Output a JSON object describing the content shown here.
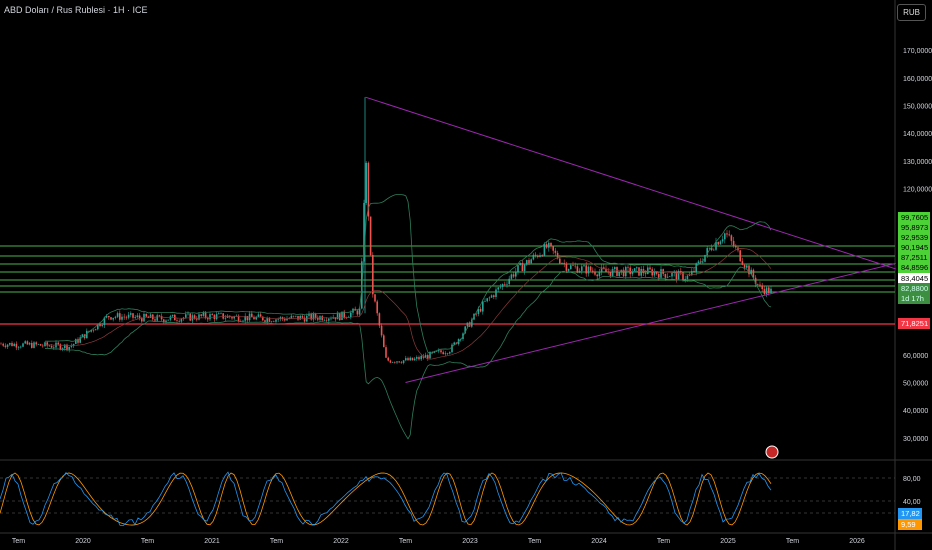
{
  "header": {
    "title": "ABD Doları / Rus Rublesi · 1H · ICE",
    "currency_button": "RUB"
  },
  "colors": {
    "up": "#26a69a",
    "down": "#ef5350",
    "green_line": "#4caf50",
    "red_line": "#f23645",
    "triangle": "#9c27b0",
    "bb": "#2e7d5b",
    "rsi": "#2196f3",
    "rsi_ma": "#ff9800"
  },
  "chart_data": {
    "type": "candlestick",
    "title": "ABD Doları / Rus Rublesi · 1H · ICE",
    "ylim": [
      20,
      180
    ],
    "y_ticks": [
      "170,0000",
      "160,0000",
      "150,0000",
      "140,0000",
      "130,0000",
      "120,0000",
      "60,0000",
      "50,0000",
      "40,0000",
      "30,0000"
    ],
    "y_tick_values": [
      170,
      160,
      150,
      140,
      130,
      120,
      60,
      50,
      40,
      30
    ],
    "x_ticks": [
      "Tem",
      "2020",
      "Tem",
      "2021",
      "Tem",
      "2022",
      "Tem",
      "2023",
      "Tem",
      "2024",
      "Tem",
      "2025",
      "Tem",
      "2026"
    ],
    "x_tick_values": [
      2019.5,
      2020,
      2020.5,
      2021,
      2021.5,
      2022,
      2022.5,
      2023,
      2023.5,
      2024,
      2024.5,
      2025,
      2025.5,
      2026
    ],
    "price_path": [
      [
        2019.36,
        64
      ],
      [
        2019.9,
        63
      ],
      [
        2020.2,
        74
      ],
      [
        2020.6,
        73
      ],
      [
        2021,
        74
      ],
      [
        2021.5,
        73
      ],
      [
        2022.0,
        74
      ],
      [
        2022.15,
        76
      ],
      [
        2022.19,
        133
      ],
      [
        2022.24,
        84
      ],
      [
        2022.35,
        58
      ],
      [
        2022.55,
        58
      ],
      [
        2022.85,
        62
      ],
      [
        2023.1,
        78
      ],
      [
        2023.35,
        90
      ],
      [
        2023.6,
        99
      ],
      [
        2023.75,
        92
      ],
      [
        2024.0,
        90
      ],
      [
        2024.4,
        90
      ],
      [
        2024.7,
        88
      ],
      [
        2024.85,
        98
      ],
      [
        2024.98,
        104
      ],
      [
        2025.1,
        95
      ],
      [
        2025.25,
        84
      ],
      [
        2025.33,
        82.9
      ]
    ],
    "level_labels": [
      {
        "text": "99,7605",
        "color": "#4caf50"
      },
      {
        "text": "95,8973",
        "color": "#4caf50"
      },
      {
        "text": "92,9539",
        "color": "#4caf50"
      },
      {
        "text": "90,1945",
        "color": "#4caf50"
      },
      {
        "text": "87,2511",
        "color": "#4caf50"
      },
      {
        "text": "84,8596",
        "color": "#4caf50"
      },
      {
        "text": "83,4045",
        "color": "#ffffff"
      },
      {
        "text": "82,8800",
        "color": "#4caf50"
      },
      {
        "text": "1d 17h",
        "color": "#4caf50"
      },
      {
        "text": "71,8251",
        "color": "#f23645"
      }
    ],
    "triangle": {
      "upper": [
        [
          2022.19,
          153
        ],
        [
          2026.3,
          91
        ]
      ],
      "lower": [
        [
          2022.5,
          50
        ],
        [
          2026.3,
          93
        ]
      ]
    },
    "rsi": {
      "ticks": [
        "80,00",
        "40,00"
      ],
      "tick_values": [
        80,
        40
      ],
      "value": "17,82",
      "ma_value": "9,59"
    }
  }
}
